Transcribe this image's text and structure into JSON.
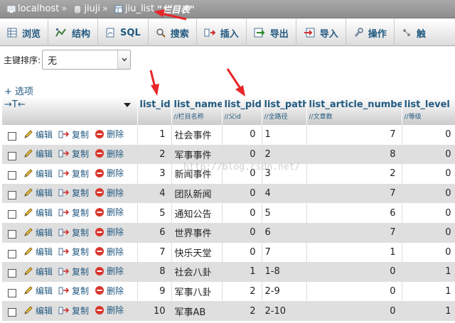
{
  "breadcrumb": {
    "server": "localhost",
    "database": "jiuji",
    "table": "jiu_list",
    "comment": "\"栏目表\"",
    "separator": "»"
  },
  "tabs": [
    {
      "label": "浏览",
      "icon": "browse-icon"
    },
    {
      "label": "结构",
      "icon": "structure-icon"
    },
    {
      "label": "SQL",
      "icon": "sql-icon"
    },
    {
      "label": "搜索",
      "icon": "search-icon"
    },
    {
      "label": "插入",
      "icon": "insert-icon"
    },
    {
      "label": "导出",
      "icon": "export-icon"
    },
    {
      "label": "导入",
      "icon": "import-icon"
    },
    {
      "label": "操作",
      "icon": "wrench-icon"
    },
    {
      "label": "触",
      "icon": "trigger-icon"
    }
  ],
  "sort": {
    "label": "主键排序:",
    "value": "无"
  },
  "options_link": "+ 选项",
  "header": {
    "arrows": "→T←",
    "columns": [
      {
        "name": "list_id",
        "comment": ""
      },
      {
        "name": "list_name",
        "comment": "//栏目名称"
      },
      {
        "name": "list_pid",
        "comment": "//父id"
      },
      {
        "name": "list_path",
        "comment": "//全路径"
      },
      {
        "name": "list_article_number",
        "comment": "//文章数"
      },
      {
        "name": "list_level",
        "comment": "//等级"
      }
    ]
  },
  "actions": {
    "edit": "编辑",
    "copy": "复制",
    "delete": "删除"
  },
  "rows": [
    {
      "id": "1",
      "name": "社会事件",
      "pid": "0",
      "path": "1",
      "articles": "7",
      "level": "0"
    },
    {
      "id": "2",
      "name": "军事事件",
      "pid": "0",
      "path": "2",
      "articles": "8",
      "level": "0"
    },
    {
      "id": "3",
      "name": "新闻事件",
      "pid": "0",
      "path": "3",
      "articles": "2",
      "level": "0"
    },
    {
      "id": "4",
      "name": "团队新闻",
      "pid": "0",
      "path": "4",
      "articles": "7",
      "level": "0"
    },
    {
      "id": "5",
      "name": "通知公告",
      "pid": "0",
      "path": "5",
      "articles": "6",
      "level": "0"
    },
    {
      "id": "6",
      "name": "世界事件",
      "pid": "0",
      "path": "6",
      "articles": "7",
      "level": "0"
    },
    {
      "id": "7",
      "name": "快乐天堂",
      "pid": "0",
      "path": "7",
      "articles": "1",
      "level": "0"
    },
    {
      "id": "8",
      "name": "社会八卦",
      "pid": "1",
      "path": "1-8",
      "articles": "0",
      "level": "1"
    },
    {
      "id": "9",
      "name": "军事八卦",
      "pid": "2",
      "path": "2-9",
      "articles": "0",
      "level": "1"
    },
    {
      "id": "10",
      "name": "军事AB",
      "pid": "2",
      "path": "2-10",
      "articles": "0",
      "level": "1"
    }
  ],
  "watermark": "http://blog.csdn.net/",
  "colors": {
    "link": "#235a81",
    "annotation": "#e8262a",
    "row_alt": "#dfdfdf"
  }
}
